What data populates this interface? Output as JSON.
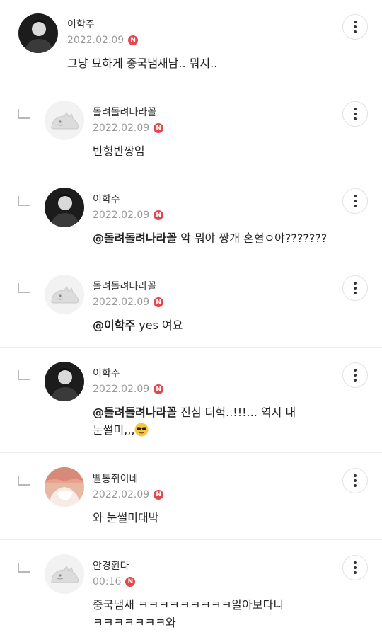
{
  "badge_letter": "N",
  "comments": [
    {
      "author": "이학주",
      "date": "2022.02.09",
      "avatar": "photo-dark",
      "text": "그냥 묘하게 중국냄새남.. 뭐지..",
      "is_reply": false
    },
    {
      "author": "돌려돌려나라꼴",
      "date": "2022.02.09",
      "avatar": "default-dino",
      "text": "반헝반짱임",
      "is_reply": true
    },
    {
      "author": "이학주",
      "date": "2022.02.09",
      "avatar": "photo-dark",
      "mention": "@돌려돌려나라꼴",
      "text": "악 뭐야 짱개 혼혈ㅇ야???????",
      "is_reply": true
    },
    {
      "author": "돌려돌려나라꼴",
      "date": "2022.02.09",
      "avatar": "default-dino",
      "mention": "@이학주",
      "text": "yes 여요",
      "is_reply": true
    },
    {
      "author": "이학주",
      "date": "2022.02.09",
      "avatar": "photo-dark",
      "mention": "@돌려돌려나라꼴",
      "text": "진심 더헉..!!!... 역시 내",
      "text_line2": "눈썰미,,,",
      "emoji": "sunglasses-emoji",
      "is_reply": true
    },
    {
      "author": "빨통쥐이네",
      "date": "2022.02.09",
      "avatar": "photo-pink",
      "text": "와 눈썰미대박",
      "is_reply": true
    },
    {
      "author": "안경휜다",
      "date": "00:16",
      "avatar": "default-dino",
      "text": "중국냄새 ㅋㅋㅋㅋㅋㅋㅋㅋㅋ알아보다니",
      "text_line2": "ㅋㅋㅋㅋㅋㅋㅋ와",
      "is_reply": true
    }
  ],
  "colors": {
    "badge": "#e4484f",
    "date": "#9a9a9a",
    "divider": "#ececec"
  }
}
